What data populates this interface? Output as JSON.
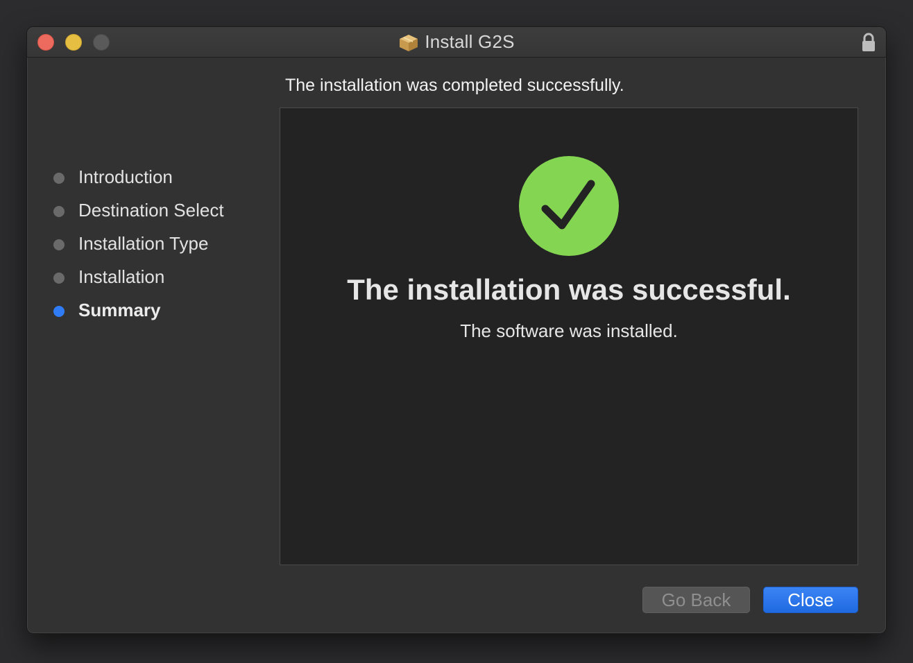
{
  "window": {
    "title": "Install G2S",
    "colors": {
      "close": "#ed6a5e",
      "minimize": "#e6bf42",
      "zoom": "#5a5a5a",
      "accent": "#2f7cf6",
      "success": "#84d552"
    }
  },
  "sidebar": {
    "items": [
      {
        "label": "Introduction",
        "active": false
      },
      {
        "label": "Destination Select",
        "active": false
      },
      {
        "label": "Installation Type",
        "active": false
      },
      {
        "label": "Installation",
        "active": false
      },
      {
        "label": "Summary",
        "active": true
      }
    ]
  },
  "main": {
    "header": "The installation was completed successfully.",
    "result_icon": "checkmark-icon",
    "result_title": "The installation was successful.",
    "result_subtitle": "The software was installed."
  },
  "buttons": {
    "go_back": "Go Back",
    "close": "Close"
  }
}
